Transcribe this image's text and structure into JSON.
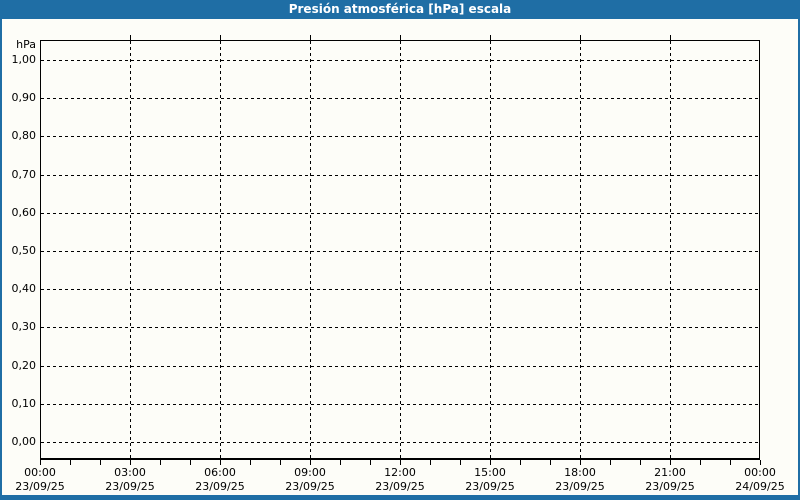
{
  "window": {
    "title": "Presión atmosférica [hPa] escala"
  },
  "colors": {
    "chrome_blue": "#1f6ea5",
    "grid": "#000000",
    "text": "#000000",
    "title_text": "#ffffff",
    "background": "#fdfdf8"
  },
  "chart_data": {
    "type": "line",
    "title": "Presión atmosférica [hPa] escala",
    "ylabel": "hPa",
    "xlabel": "",
    "ylim": [
      0.0,
      1.0
    ],
    "y_tick_step": 0.1,
    "y_tick_labels": [
      "1,00",
      "0,90",
      "0,80",
      "0,70",
      "0,60",
      "0,50",
      "0,40",
      "0,30",
      "0,20",
      "0,10",
      "0,00"
    ],
    "x_tick_labels": [
      {
        "time": "00:00",
        "date": "23/09/25"
      },
      {
        "time": "03:00",
        "date": "23/09/25"
      },
      {
        "time": "06:00",
        "date": "23/09/25"
      },
      {
        "time": "09:00",
        "date": "23/09/25"
      },
      {
        "time": "12:00",
        "date": "23/09/25"
      },
      {
        "time": "15:00",
        "date": "23/09/25"
      },
      {
        "time": "18:00",
        "date": "23/09/25"
      },
      {
        "time": "21:00",
        "date": "23/09/25"
      },
      {
        "time": "00:00",
        "date": "24/09/25"
      }
    ],
    "x_major_tick_interval_hours": 3,
    "x_minor_tick_interval_hours": 1,
    "grid": true,
    "legend": false,
    "series": []
  }
}
